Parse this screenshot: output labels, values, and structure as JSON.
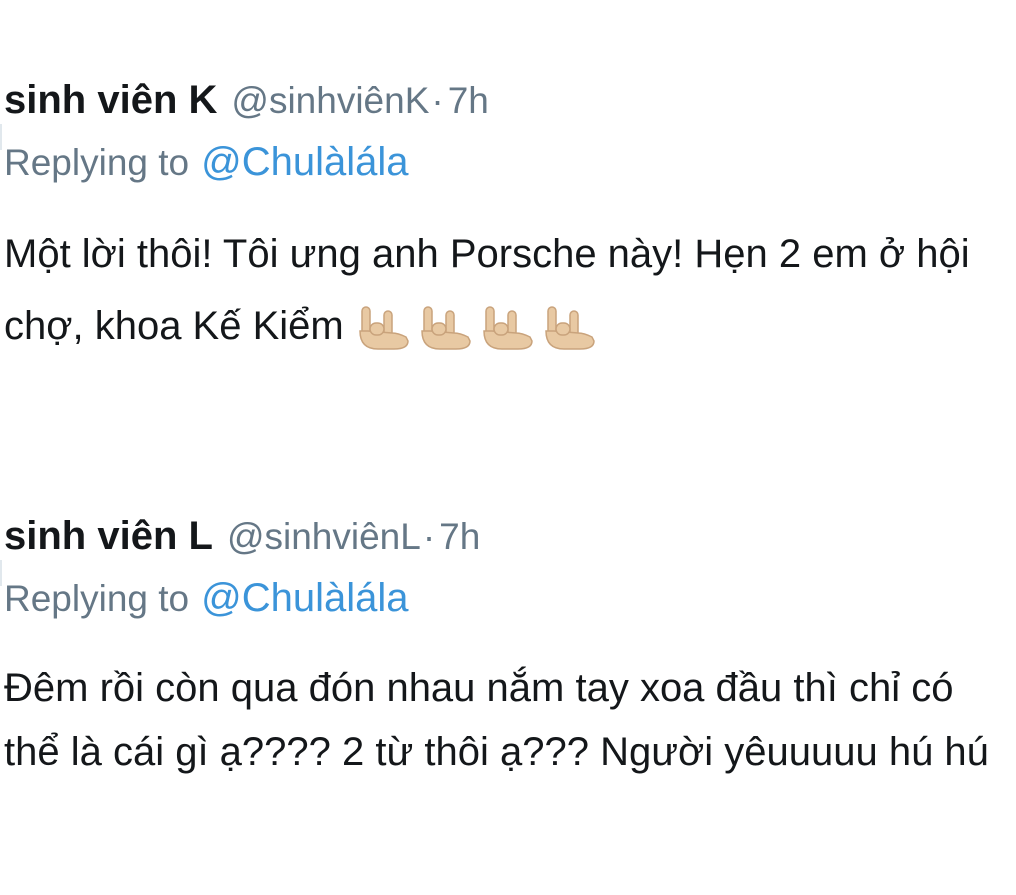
{
  "tweets": [
    {
      "display_name": "sinh viên K",
      "handle": "@sinhviênK",
      "separator": "·",
      "time": "7h",
      "replying_prefix": "Replying to",
      "replying_to": "@Chulàlála",
      "text": "Một lời thôi! Tôi ưng anh Porsche này! Hẹn 2 em ở hội chợ, khoa Kế Kiểm",
      "emojis": [
        "sign-of-horns-emoji",
        "sign-of-horns-emoji",
        "sign-of-horns-emoji",
        "sign-of-horns-emoji"
      ],
      "emoji_color": "#e8c9a3"
    },
    {
      "display_name": "sinh viên L",
      "handle": "@sinhviênL",
      "separator": "·",
      "time": "7h",
      "replying_prefix": "Replying to",
      "replying_to": "@Chulàlála",
      "text": "Đêm rồi còn qua đón nhau nắm tay xoa đầu thì chỉ có thể là cái gì ạ???? 2 từ thôi ạ??? Người yêuuuuu hú hú"
    }
  ],
  "colors": {
    "name": "#14171a",
    "muted": "#657786",
    "mention": "#3b94d9"
  }
}
